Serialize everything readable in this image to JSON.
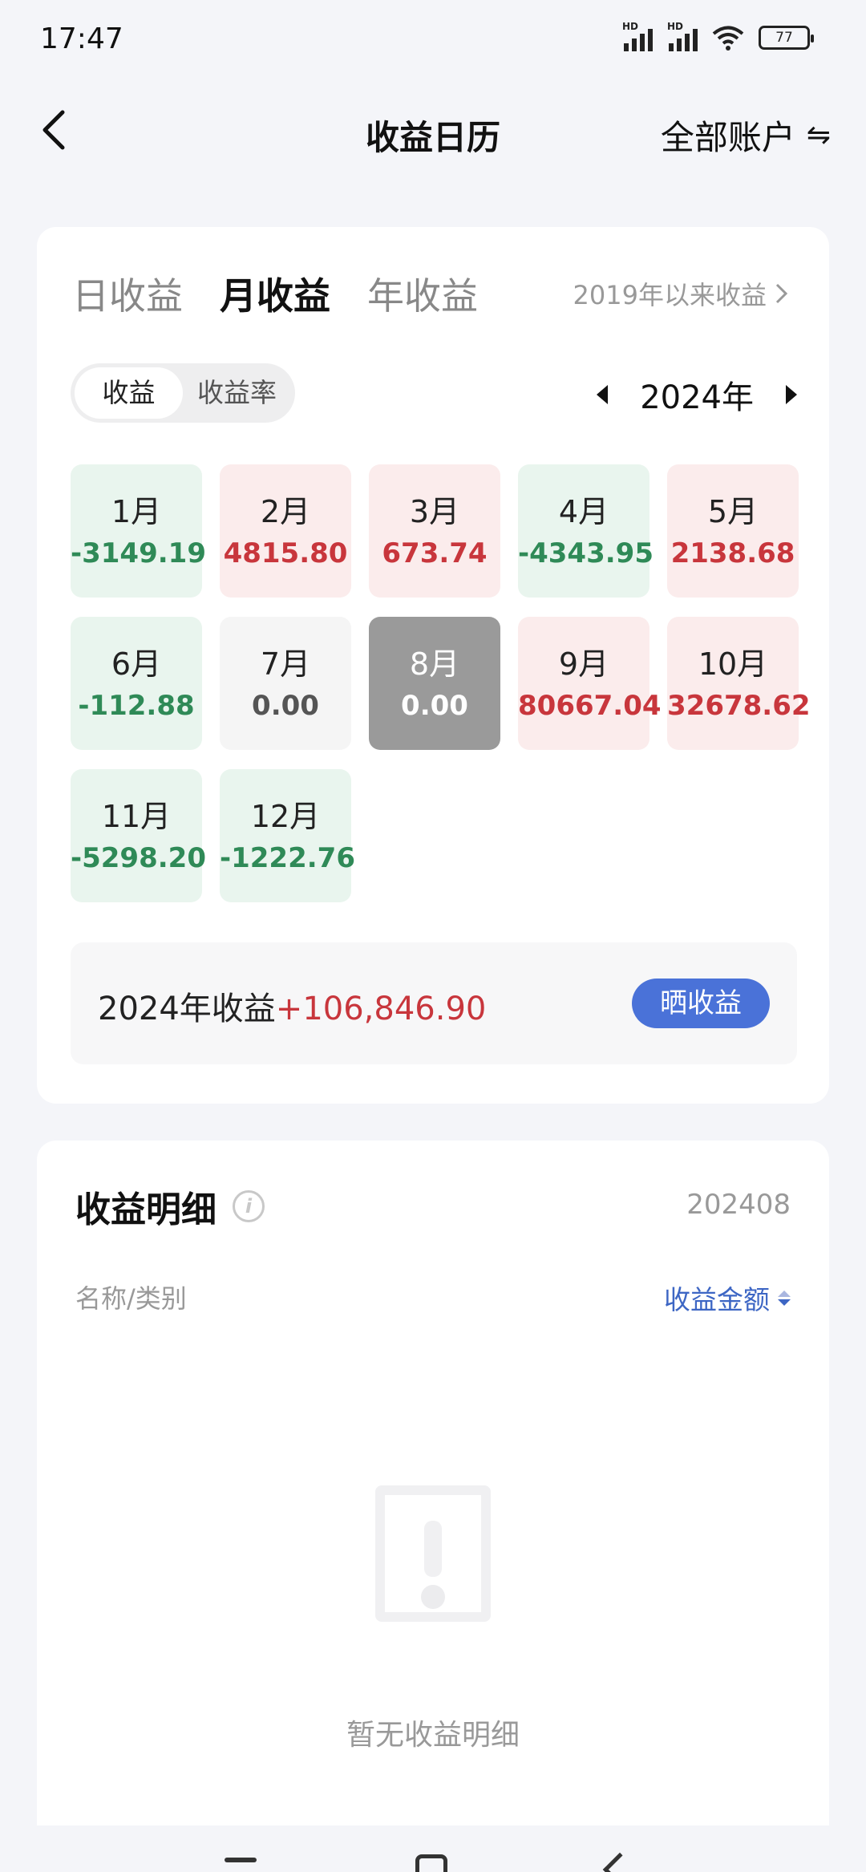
{
  "status_bar": {
    "time": "17:47",
    "hd_label": "HD",
    "battery": "77"
  },
  "header": {
    "title": "收益日历",
    "account_label": "全部账户",
    "swap_icon": "⇋"
  },
  "tabs": [
    {
      "label": "日收益",
      "active": false
    },
    {
      "label": "月收益",
      "active": true
    },
    {
      "label": "年收益",
      "active": false
    }
  ],
  "since_link": "2019年以来收益",
  "toggle": [
    "收益",
    "收益率"
  ],
  "year": "2024年",
  "months": [
    {
      "label": "1月",
      "value": "-3149.19",
      "state": "neg"
    },
    {
      "label": "2月",
      "value": "4815.80",
      "state": "pos"
    },
    {
      "label": "3月",
      "value": "673.74",
      "state": "pos"
    },
    {
      "label": "4月",
      "value": "-4343.95",
      "state": "neg"
    },
    {
      "label": "5月",
      "value": "2138.68",
      "state": "pos"
    },
    {
      "label": "6月",
      "value": "-112.88",
      "state": "neg"
    },
    {
      "label": "7月",
      "value": "0.00",
      "state": "zero"
    },
    {
      "label": "8月",
      "value": "0.00",
      "state": "sel"
    },
    {
      "label": "9月",
      "value": "80667.04",
      "state": "pos"
    },
    {
      "label": "10月",
      "value": "32678.62",
      "state": "pos"
    },
    {
      "label": "11月",
      "value": "-5298.20",
      "state": "neg"
    },
    {
      "label": "12月",
      "value": "-1222.76",
      "state": "neg"
    }
  ],
  "summary": {
    "label": "2024年收益",
    "amount": "+106,846.90",
    "share_button": "晒收益"
  },
  "detail": {
    "title": "收益明细",
    "period": "202408",
    "col_name": "名称/类别",
    "col_amount": "收益金额",
    "empty_text": "暂无收益明细"
  },
  "colors": {
    "positive": "#c8363c",
    "negative": "#2f8a57",
    "accent": "#4a72d8"
  }
}
